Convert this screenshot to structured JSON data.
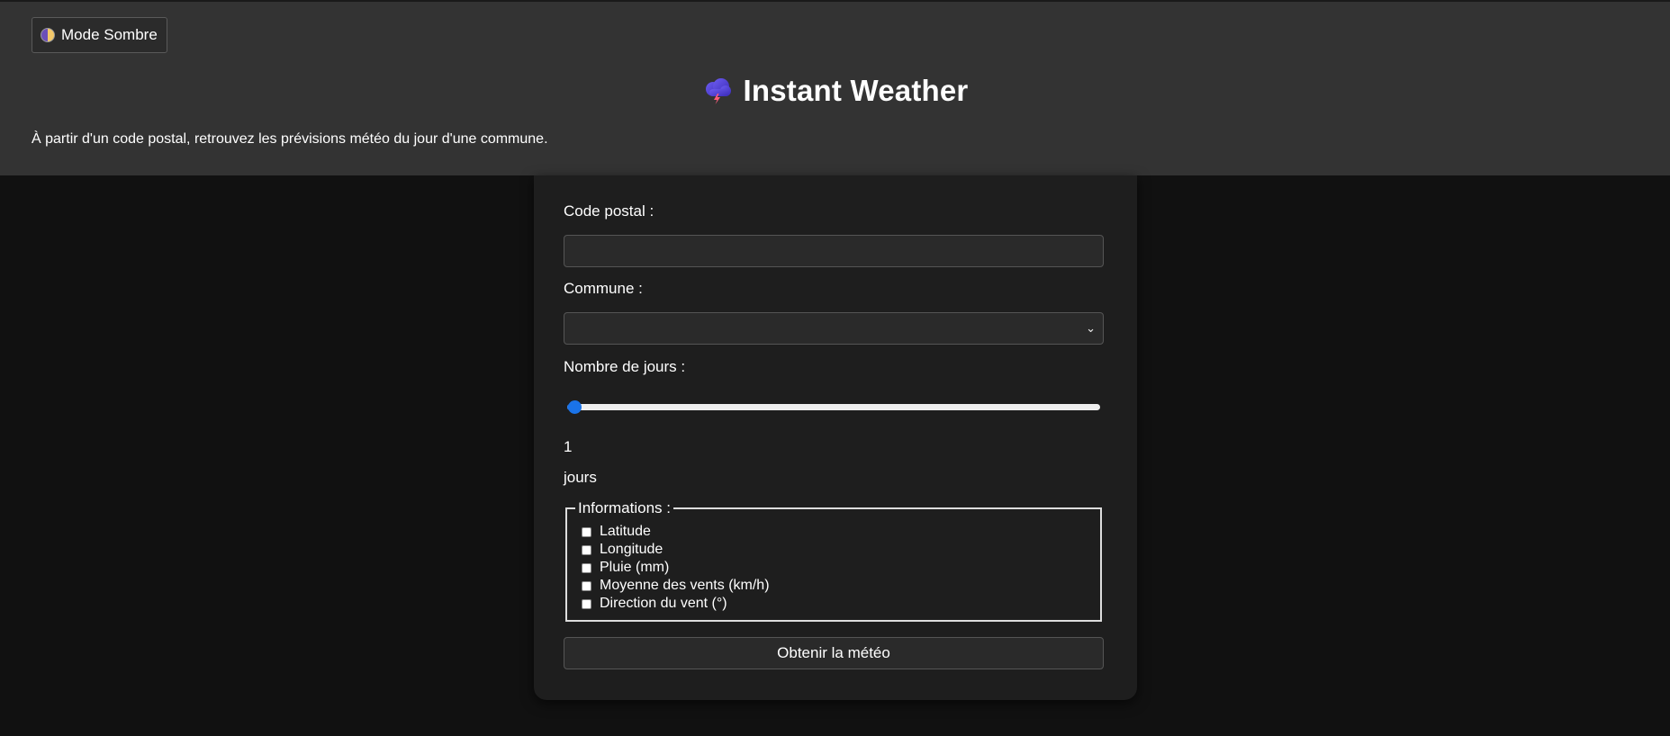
{
  "header": {
    "mode_button_label": "Mode Sombre",
    "mode_icon": "half-moon-icon",
    "logo_icon": "storm-cloud-icon",
    "title": "Instant Weather",
    "subtitle": "À partir d'un code postal, retrouvez les prévisions météo du jour d'une commune."
  },
  "form": {
    "postal_code_label": "Code postal :",
    "postal_code_value": "",
    "commune_label": "Commune :",
    "commune_selected": "",
    "days_label": "Nombre de jours :",
    "days_slider": {
      "value": 1,
      "min": 1,
      "max": 7
    },
    "days_value": "1",
    "days_unit": "jours",
    "info_legend": "Informations :",
    "info_options": [
      {
        "label": "Latitude",
        "checked": false
      },
      {
        "label": "Longitude",
        "checked": false
      },
      {
        "label": "Pluie (mm)",
        "checked": false
      },
      {
        "label": "Moyenne des vents (km/h)",
        "checked": false
      },
      {
        "label": "Direction du vent (°)",
        "checked": false
      }
    ],
    "submit_label": "Obtenir la météo"
  },
  "colors": {
    "header_bg": "#333333",
    "page_bg": "#111111",
    "card_bg": "#1e1e1e",
    "accent": "#1a73e8"
  }
}
